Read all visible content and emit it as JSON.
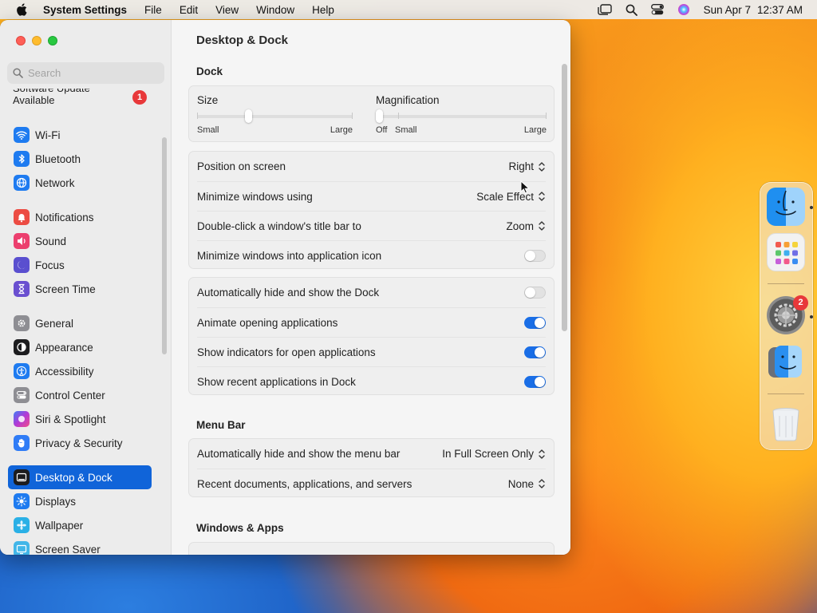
{
  "menubar": {
    "app_name": "System Settings",
    "menus": [
      "File",
      "Edit",
      "View",
      "Window",
      "Help"
    ],
    "clock_date": "Sun Apr 7",
    "clock_time": "12:37 AM"
  },
  "sidebar": {
    "search_placeholder": "Search",
    "update_label": "Software Update Available",
    "update_badge": "1",
    "items": [
      {
        "label": "Wi-Fi",
        "icon": "wifi-icon",
        "color": "#1e7bf0"
      },
      {
        "label": "Bluetooth",
        "icon": "bluetooth-icon",
        "color": "#1e7bf0"
      },
      {
        "label": "Network",
        "icon": "globe-icon",
        "color": "#1e7bf0"
      },
      {
        "label": "Notifications",
        "icon": "bell-icon",
        "color": "#ec4c43"
      },
      {
        "label": "Sound",
        "icon": "speaker-icon",
        "color": "#ec3f6e"
      },
      {
        "label": "Focus",
        "icon": "moon-icon",
        "color": "#5a4fcf"
      },
      {
        "label": "Screen Time",
        "icon": "hourglass-icon",
        "color": "#6a4fd0"
      },
      {
        "label": "General",
        "icon": "gear-icon",
        "color": "#8e8e93"
      },
      {
        "label": "Appearance",
        "icon": "appearance-icon",
        "color": "#1c1c1e"
      },
      {
        "label": "Accessibility",
        "icon": "accessibility-icon",
        "color": "#1e7bf0"
      },
      {
        "label": "Control Center",
        "icon": "control-center-icon",
        "color": "#8e8e93"
      },
      {
        "label": "Siri & Spotlight",
        "icon": "siri-icon",
        "color": "#b23ad6"
      },
      {
        "label": "Privacy & Security",
        "icon": "hand-icon",
        "color": "#2f7cf6"
      },
      {
        "label": "Desktop & Dock",
        "icon": "dock-icon",
        "color": "#1c1c1e"
      },
      {
        "label": "Displays",
        "icon": "sun-icon",
        "color": "#1e7bf0"
      },
      {
        "label": "Wallpaper",
        "icon": "flower-icon",
        "color": "#2ab0e6"
      },
      {
        "label": "Screen Saver",
        "icon": "screensaver-icon",
        "color": "#42b6e8"
      }
    ],
    "active": "Desktop & Dock"
  },
  "main": {
    "title": "Desktop & Dock",
    "dock_section": "Dock",
    "size_label": "Size",
    "size_min": "Small",
    "size_max": "Large",
    "size_value": 0.32,
    "magnification_label": "Magnification",
    "magnification_off": "Off",
    "magnification_min": "Small",
    "magnification_max": "Large",
    "magnification_value": 0,
    "rows": {
      "position_label": "Position on screen",
      "position_value": "Right",
      "minimize_label": "Minimize windows using",
      "minimize_value": "Scale Effect",
      "doubleclick_label": "Double-click a window's title bar to",
      "doubleclick_value": "Zoom",
      "minimize_icon_label": "Minimize windows into application icon",
      "autohide_label": "Automatically hide and show the Dock",
      "animate_label": "Animate opening applications",
      "indicators_label": "Show indicators for open applications",
      "recent_label": "Show recent applications in Dock"
    },
    "toggles": {
      "minimize_icon": false,
      "autohide": false,
      "animate": true,
      "indicators": true,
      "recent": true
    },
    "menubar_section": "Menu Bar",
    "menubar_rows": {
      "autohide_menubar_label": "Automatically hide and show the menu bar",
      "autohide_menubar_value": "In Full Screen Only",
      "recent_docs_label": "Recent documents, applications, and servers",
      "recent_docs_value": "None"
    },
    "windows_section": "Windows & Apps"
  },
  "dock": {
    "items": [
      "Finder",
      "Launchpad",
      "System Settings",
      "Finder",
      "Trash"
    ],
    "settings_badge": "2"
  }
}
